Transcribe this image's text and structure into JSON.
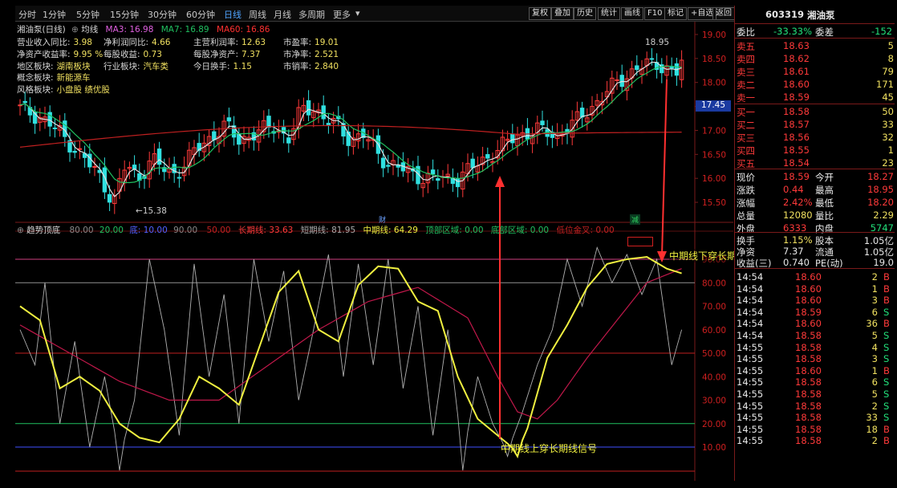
{
  "toolbar": {
    "periods": [
      "分时",
      "1分钟",
      "5分钟",
      "15分钟",
      "30分钟",
      "60分钟",
      "日线",
      "周线",
      "月线",
      "多周期",
      "更多"
    ],
    "active_period": "日线",
    "buttons": [
      "复权",
      "叠加",
      "历史",
      "统计",
      "画线",
      "F10",
      "标记",
      "+自选",
      "返回"
    ]
  },
  "kline": {
    "name": "湘油泵(日线)",
    "ma_label": "均线",
    "ma3": "MA3: 16.98",
    "ma7": "MA7: 16.89",
    "ma60": "MA60: 16.86",
    "high_label": "18.95",
    "low_label": "15.38",
    "current_price_tag": "17.45",
    "badge1": "财",
    "badge2": "减",
    "price_axis": [
      "19.00",
      "18.50",
      "18.00",
      "17.50",
      "17.00",
      "16.50",
      "16.00",
      "15.50"
    ]
  },
  "fundamentals": [
    {
      "k": "营业收入同比:",
      "v": "3.98"
    },
    {
      "k": "净利润同比:",
      "v": "4.66"
    },
    {
      "k": "主营利润率:",
      "v": "12.63"
    },
    {
      "k": "市盈率:",
      "v": "19.01"
    },
    {
      "k": "净资产收益率:",
      "v": "9.95 %"
    },
    {
      "k": "每股收益:",
      "v": "0.73"
    },
    {
      "k": "每股净资产:",
      "v": "7.37"
    },
    {
      "k": "市净率:",
      "v": "2.521"
    },
    {
      "k": "地区板块:",
      "v": "湖南板块"
    },
    {
      "k": "行业板块:",
      "v": "汽车类"
    },
    {
      "k": "今日换手:",
      "v": "1.15"
    },
    {
      "k": "市销率:",
      "v": "2.840"
    },
    {
      "k": "概念板块:",
      "v": "新能源车"
    },
    {
      "k": "风格板块:",
      "v": "小盘股 绩优股"
    }
  ],
  "indicator": {
    "name": "趋势顶底",
    "levels": [
      "80.00",
      "20.00",
      "底: 10.00",
      "90.00",
      "50.00"
    ],
    "long_line": "长期线: 33.63",
    "short_line": "短期线: 81.95",
    "mid_line": "中期线: 64.29",
    "top_zone": "顶部区域: 0.00",
    "bottom_zone": "底部区域: 0.00",
    "buy_sell": "低位金叉: 0.00",
    "axis": [
      "90.00",
      "80.00",
      "70.00",
      "60.00",
      "50.00",
      "40.00",
      "30.00",
      "20.00",
      "10.00"
    ],
    "annotation_up": "中期线上穿长期线信号",
    "annotation_down": "中期线下穿长期线信号"
  },
  "colors": {
    "up": "#ff3a3a",
    "down": "#30e0e0",
    "ma3": "#e0e0e0",
    "ma7": "#20c060",
    "ma60": "#c02020",
    "mid": "#f0f040",
    "long": "#c0184a",
    "short": "#b0b0b0",
    "arrow": "#ff3030"
  },
  "panel": {
    "code": "603319",
    "name": "湘油泵",
    "weibi_label": "委比",
    "weibi_value": "-33.33%",
    "weicha_label": "委差",
    "weicha_value": "-152",
    "asks": [
      {
        "label": "卖五",
        "price": "18.63",
        "vol": "5"
      },
      {
        "label": "卖四",
        "price": "18.62",
        "vol": "8"
      },
      {
        "label": "卖三",
        "price": "18.61",
        "vol": "79"
      },
      {
        "label": "卖二",
        "price": "18.60",
        "vol": "171"
      },
      {
        "label": "卖一",
        "price": "18.59",
        "vol": "45"
      }
    ],
    "bids": [
      {
        "label": "买一",
        "price": "18.58",
        "vol": "50"
      },
      {
        "label": "买二",
        "price": "18.57",
        "vol": "33"
      },
      {
        "label": "买三",
        "price": "18.56",
        "vol": "32"
      },
      {
        "label": "买四",
        "price": "18.55",
        "vol": "1"
      },
      {
        "label": "买五",
        "price": "18.54",
        "vol": "23"
      }
    ],
    "quote": [
      {
        "l1": "现价",
        "v1": "18.59",
        "l2": "今开",
        "v2": "18.27"
      },
      {
        "l1": "涨跌",
        "v1": "0.44",
        "l2": "最高",
        "v2": "18.95"
      },
      {
        "l1": "涨幅",
        "v1": "2.42%",
        "l2": "最低",
        "v2": "18.20"
      },
      {
        "l1": "总量",
        "v1": "12080",
        "l2": "量比",
        "v2": "2.29"
      },
      {
        "l1": "外盘",
        "v1": "6333",
        "l2": "内盘",
        "v2": "5747"
      }
    ],
    "stats": [
      {
        "l1": "换手",
        "v1": "1.15%",
        "l2": "股本",
        "v2": "1.05亿"
      },
      {
        "l1": "净资",
        "v1": "7.37",
        "l2": "流通",
        "v2": "1.05亿"
      },
      {
        "l1": "收益(三)",
        "v1": "0.740",
        "l2": "PE(动)",
        "v2": "19.0"
      }
    ],
    "ticks": [
      {
        "t": "14:54",
        "p": "18.60",
        "v": "2",
        "d": "B"
      },
      {
        "t": "14:54",
        "p": "18.60",
        "v": "1",
        "d": "B"
      },
      {
        "t": "14:54",
        "p": "18.60",
        "v": "3",
        "d": "B"
      },
      {
        "t": "14:54",
        "p": "18.59",
        "v": "6",
        "d": "S"
      },
      {
        "t": "14:54",
        "p": "18.60",
        "v": "36",
        "d": "B"
      },
      {
        "t": "14:54",
        "p": "18.58",
        "v": "5",
        "d": "S"
      },
      {
        "t": "14:55",
        "p": "18.58",
        "v": "4",
        "d": "S"
      },
      {
        "t": "14:55",
        "p": "18.58",
        "v": "3",
        "d": "S"
      },
      {
        "t": "14:55",
        "p": "18.60",
        "v": "1",
        "d": "B"
      },
      {
        "t": "14:55",
        "p": "18.58",
        "v": "6",
        "d": "S"
      },
      {
        "t": "14:55",
        "p": "18.58",
        "v": "5",
        "d": "S"
      },
      {
        "t": "14:55",
        "p": "18.58",
        "v": "2",
        "d": "S"
      },
      {
        "t": "14:55",
        "p": "18.58",
        "v": "33",
        "d": "S"
      },
      {
        "t": "14:55",
        "p": "18.58",
        "v": "18",
        "d": "B"
      },
      {
        "t": "14:55",
        "p": "18.58",
        "v": "2",
        "d": "B"
      }
    ]
  }
}
